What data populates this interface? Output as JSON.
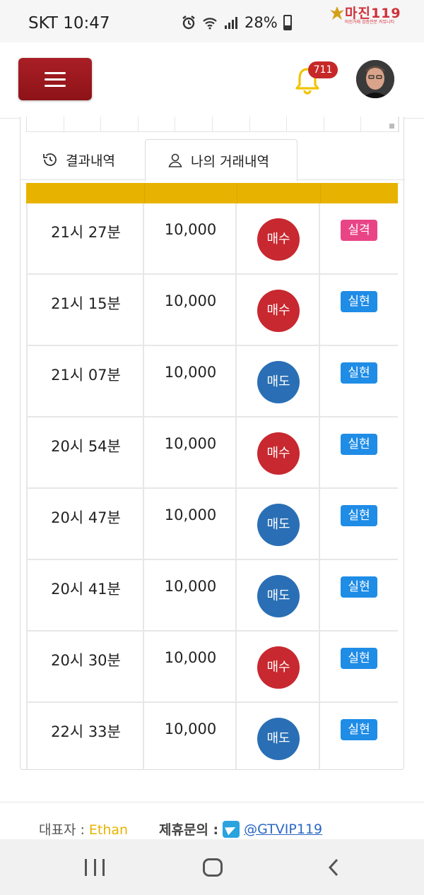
{
  "status_bar": {
    "carrier_time": "SKT 10:47",
    "battery_percent": "28%",
    "watermark_title": "마진119",
    "watermark_subtitle": "마진거래 검증전문 커뮤니티"
  },
  "header": {
    "notification_count": "711"
  },
  "tabs": [
    {
      "label": "결과내역",
      "active": false
    },
    {
      "label": "나의 거래내역",
      "active": true
    }
  ],
  "trades": [
    {
      "time": "21시 27분",
      "amount": "10,000",
      "side": "매수",
      "side_type": "buy",
      "result": "실격",
      "result_type": "fail"
    },
    {
      "time": "21시 15분",
      "amount": "10,000",
      "side": "매수",
      "side_type": "buy",
      "result": "실현",
      "result_type": "ok"
    },
    {
      "time": "21시 07분",
      "amount": "10,000",
      "side": "매도",
      "side_type": "sell",
      "result": "실현",
      "result_type": "ok"
    },
    {
      "time": "20시 54분",
      "amount": "10,000",
      "side": "매수",
      "side_type": "buy",
      "result": "실현",
      "result_type": "ok"
    },
    {
      "time": "20시 47분",
      "amount": "10,000",
      "side": "매도",
      "side_type": "sell",
      "result": "실현",
      "result_type": "ok"
    },
    {
      "time": "20시 41분",
      "amount": "10,000",
      "side": "매도",
      "side_type": "sell",
      "result": "실현",
      "result_type": "ok"
    },
    {
      "time": "20시 30분",
      "amount": "10,000",
      "side": "매수",
      "side_type": "buy",
      "result": "실현",
      "result_type": "ok"
    },
    {
      "time": "22시 33분",
      "amount": "10,000",
      "side": "매도",
      "side_type": "sell",
      "result": "실현",
      "result_type": "ok"
    }
  ],
  "footer": {
    "rep_label": "대표자 : ",
    "rep_name": "Ethan",
    "contact_label": "제휴문의 :",
    "contact_handle": "@GTVIP119"
  },
  "colors": {
    "header_bar": "#e8b300",
    "buy": "#c8282f",
    "sell": "#2a6fb5",
    "fail_badge": "#e94586",
    "ok_badge": "#1f8ce6",
    "menu_button": "#a91e25"
  },
  "icons": [
    "alarm-icon",
    "wifi-icon",
    "signal-icon",
    "battery-icon",
    "menu-icon",
    "bell-icon",
    "history-icon",
    "user-icon",
    "telegram-icon",
    "recent-apps-icon",
    "home-icon",
    "back-icon"
  ]
}
